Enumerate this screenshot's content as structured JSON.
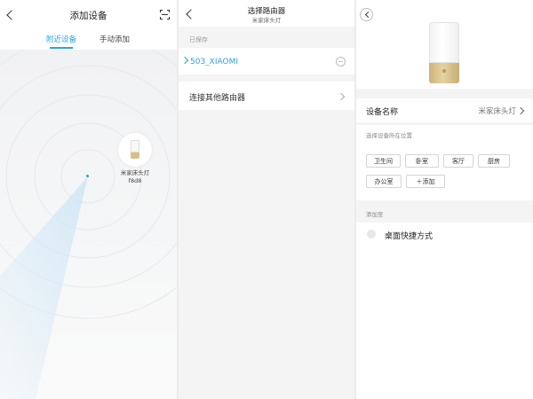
{
  "screen1": {
    "title": "添加设备",
    "tabs": {
      "nearby": "附近设备",
      "manual": "手动添加"
    },
    "device": {
      "name": "米家床头灯",
      "id": "f8d8"
    },
    "accent": "#27a3ea"
  },
  "screen2": {
    "title": "选择路由器",
    "subtitle": "米家床头灯",
    "saved_label": "已保存",
    "saved_network": "503_XIAOMI",
    "other_router": "连接其他路由器"
  },
  "screen3": {
    "device_name_label": "设备名称",
    "device_name_value": "米家床头灯",
    "location_hint": "选择设备所在位置",
    "locations": [
      "卫生间",
      "卧室",
      "客厅",
      "厨房",
      "办公室",
      "＋添加"
    ],
    "add_to_label": "添加至",
    "shortcut": "桌面快捷方式",
    "lamp_base_color": "#d8bf86"
  }
}
